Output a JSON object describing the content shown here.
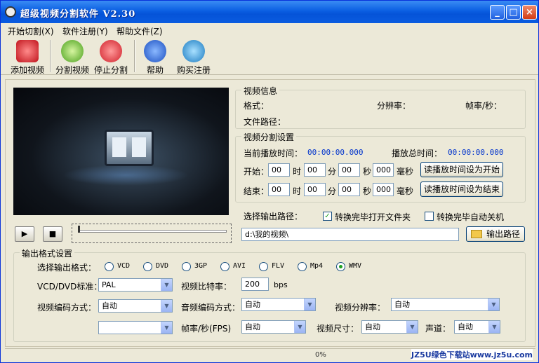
{
  "window": {
    "title": "超级视频分割软件 V2.30",
    "min": "_",
    "max": "□",
    "close": "×"
  },
  "menu": [
    "开始切割(X)",
    "软件注册(Y)",
    "帮助文件(Z)"
  ],
  "toolbar": [
    "添加视频",
    "分割视频",
    "停止分割",
    "帮助",
    "购买注册"
  ],
  "info": {
    "legend": "视频信息",
    "format": "格式：",
    "resolution": "分辨率：",
    "fps": "帧率/秒：",
    "path": "文件路径："
  },
  "split": {
    "legend": "视频分割设置",
    "current_label": "当前播放时间：",
    "current": "00:00:00.000",
    "total_label": "播放总时间：",
    "total": "00:00:00.000",
    "start_label": "开始：",
    "end_label": "结束：",
    "hour": "时",
    "min": "分",
    "sec": "秒",
    "ms": "毫秒",
    "start": [
      "00",
      "00",
      "00",
      "000"
    ],
    "end": [
      "00",
      "00",
      "00",
      "000"
    ],
    "set_start": "读播放时间设为开始",
    "set_end": "读播放时间设为结束"
  },
  "output": {
    "path_label": "选择输出路径：",
    "open_folder": "转换完毕打开文件夹",
    "shutdown": "转换完毕自动关机",
    "path_value": "d:\\我的视频\\",
    "path_button": "输出路径"
  },
  "format": {
    "legend": "输出格式设置",
    "select_label": "选择输出格式：",
    "options": [
      "VCD",
      "DVD",
      "3GP",
      "AVI",
      "FLV",
      "Mp4",
      "WMV"
    ],
    "vcd_label": "VCD/DVD标准：",
    "vcd_value": "PAL",
    "bitrate_label": "视频比特率：",
    "bitrate": "200",
    "bps": "bps",
    "vcodec_label": "视频编码方式：",
    "vcodec": "自动",
    "acodec_label": "音频编码方式：",
    "acodec": "自动",
    "vres_label": "视频分辨率：",
    "vres": "自动",
    "fps_label": "帧率/秒(FPS)",
    "fps": "自动",
    "size_label": "视频尺寸：",
    "size": "自动",
    "channel_label": "声道：",
    "channel": "自动"
  },
  "status": {
    "progress": "0%",
    "watermark": "JZ5U绿色下载站www.jz5u.com"
  }
}
